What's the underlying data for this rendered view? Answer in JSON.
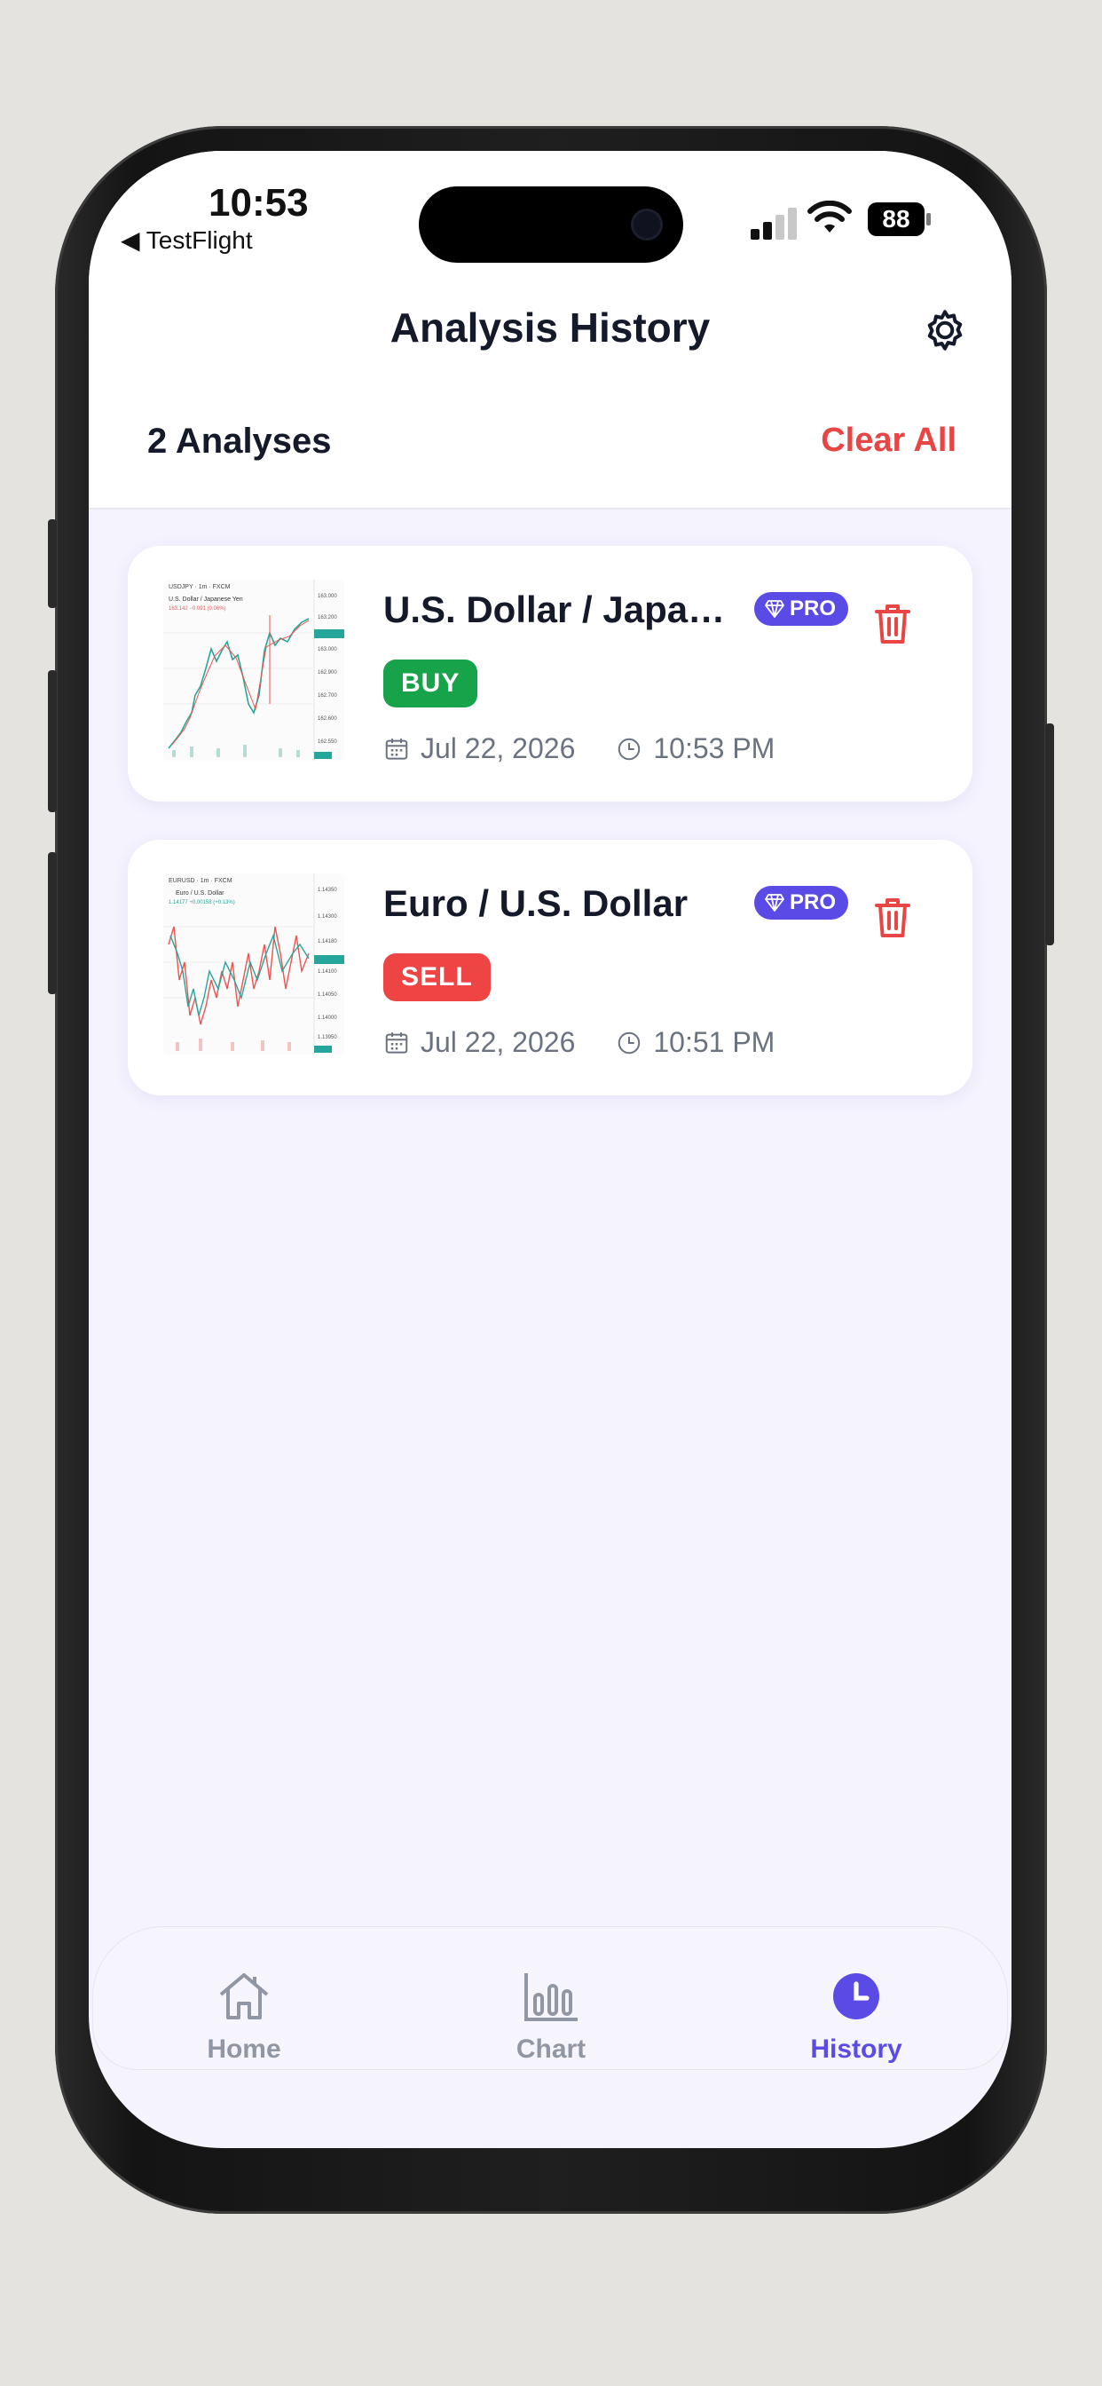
{
  "status": {
    "time": "10:53",
    "back_app": "◀ TestFlight",
    "battery": "88"
  },
  "header": {
    "title": "Analysis History"
  },
  "summary": {
    "count_label": "2 Analyses",
    "clear_label": "Clear All"
  },
  "analyses": [
    {
      "title": "U.S. Dollar / Japan...",
      "badge": "PRO",
      "signal": "BUY",
      "date": "Jul 22, 2026",
      "time": "10:53 PM"
    },
    {
      "title": "Euro / U.S. Dollar",
      "badge": "PRO",
      "signal": "SELL",
      "date": "Jul 22, 2026",
      "time": "10:51 PM"
    }
  ],
  "tabs": [
    {
      "label": "Home",
      "icon": "home-icon"
    },
    {
      "label": "Chart",
      "icon": "bar-chart-icon"
    },
    {
      "label": "History",
      "icon": "clock-icon"
    }
  ],
  "colors": {
    "accent": "#5b4be6",
    "buy": "#16a34a",
    "sell": "#ef4444",
    "clear": "#e84545",
    "background": "#f4f3fe"
  }
}
